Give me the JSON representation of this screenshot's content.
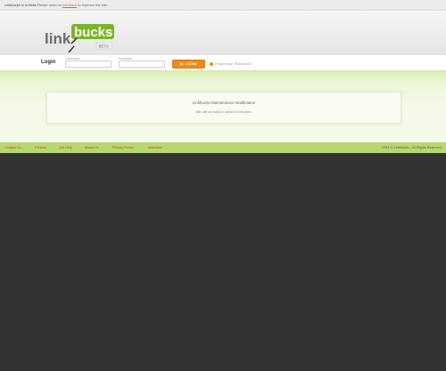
{
  "topbar": {
    "brand": "Linkbucks is in Beta",
    "text_before": "Please send us ",
    "link": "feedback",
    "text_after": " to improve the site."
  },
  "logo": {
    "word1": "link",
    "word2": "bucks",
    "tag": "BETA"
  },
  "login": {
    "title": "Login",
    "username_label": "Username",
    "password_label": "Password",
    "button_label": "LOGIN",
    "forgot_label": "Forgot your Password?"
  },
  "notice": {
    "title": "Linkbucks Maintenance Notification",
    "text": "We will be back in about 5 minutes."
  },
  "footer": {
    "links": [
      "Contact Us",
      "Forums",
      "Get Help",
      "About Us",
      "Privacy Policy",
      "Advertise"
    ],
    "copyright": "2011 © Linkbucks - All Rights Reserved"
  },
  "colors": {
    "accent_orange": "#f08a1a",
    "logo_green": "#7ab527",
    "footer_green": "#b7d770",
    "footer_link": "#cc4a00",
    "dark_bg": "#333333"
  }
}
